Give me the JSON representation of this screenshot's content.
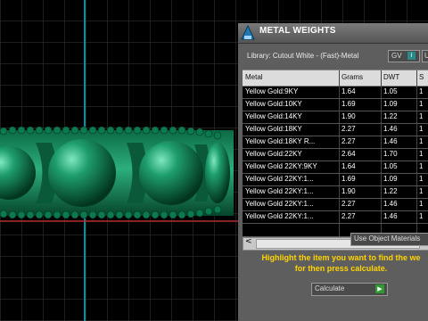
{
  "panel": {
    "title": "METAL WEIGHTS",
    "library_line": "Library: Cutout White - (Fast)-Metal",
    "gv_label": "GV",
    "gv_button": "i",
    "cut_button": "Us",
    "columns": [
      "Metal",
      "Grams",
      "DWT",
      "S"
    ],
    "rows": [
      {
        "metal": "Yellow Gold:9KY",
        "grams": "1.64",
        "dwt": "1.05",
        "s": "1"
      },
      {
        "metal": "Yellow Gold:10KY",
        "grams": "1.69",
        "dwt": "1.09",
        "s": "1"
      },
      {
        "metal": "Yellow Gold:14KY",
        "grams": "1.90",
        "dwt": "1.22",
        "s": "1"
      },
      {
        "metal": "Yellow Gold:18KY",
        "grams": "2.27",
        "dwt": "1.46",
        "s": "1"
      },
      {
        "metal": "Yellow Gold:18KY R...",
        "grams": "2.27",
        "dwt": "1.46",
        "s": "1"
      },
      {
        "metal": "Yellow Gold:22KY",
        "grams": "2.64",
        "dwt": "1.70",
        "s": "1"
      },
      {
        "metal": "Yellow Gold 22KY:9KY",
        "grams": "1.64",
        "dwt": "1.05",
        "s": "1"
      },
      {
        "metal": "Yellow Gold 22KY:1...",
        "grams": "1.69",
        "dwt": "1.09",
        "s": "1"
      },
      {
        "metal": "Yellow Gold 22KY:1...",
        "grams": "1.90",
        "dwt": "1.22",
        "s": "1"
      },
      {
        "metal": "Yellow Gold 22KY:1...",
        "grams": "2.27",
        "dwt": "1.46",
        "s": "1"
      },
      {
        "metal": "Yellow Gold 22KY:1...",
        "grams": "2.27",
        "dwt": "1.46",
        "s": "1"
      }
    ],
    "scroll_left": "<",
    "dropdown_value": "Use Object Materials",
    "instruction": "Highlight the item you want to find the we\nfor then press calculate.",
    "calculate_label": "Calculate",
    "calculate_icon": "play-icon"
  }
}
